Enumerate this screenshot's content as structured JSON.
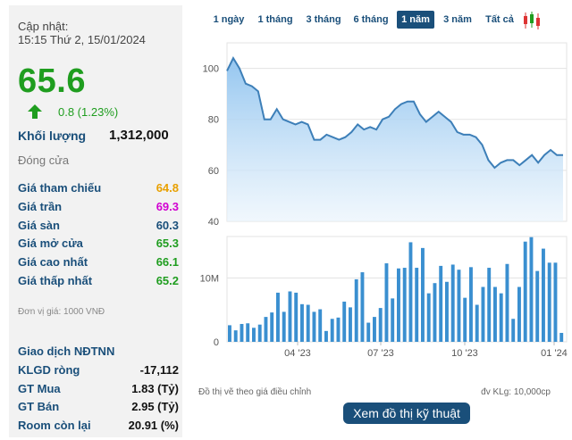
{
  "header": {
    "update_label": "Cập nhật:",
    "update_time": "15:15 Thứ 2, 15/01/2024",
    "price": "65.6",
    "change": "0.8 (1.23%)",
    "volume_label": "Khối lượng",
    "volume_value": "1,312,000",
    "status": "Đóng cửa"
  },
  "prices": [
    {
      "label": "Giá tham chiếu",
      "value": "64.8",
      "color": "#e8a000"
    },
    {
      "label": "Giá trần",
      "value": "69.3",
      "color": "#d100d1"
    },
    {
      "label": "Giá sàn",
      "value": "60.3",
      "color": "#1a4f7a"
    },
    {
      "label": "Giá mở cửa",
      "value": "65.3",
      "color": "#1f9d1f"
    },
    {
      "label": "Giá cao nhất",
      "value": "66.1",
      "color": "#1f9d1f"
    },
    {
      "label": "Giá thấp nhất",
      "value": "65.2",
      "color": "#1f9d1f"
    }
  ],
  "unit_note": "Đơn vị giá: 1000 VNĐ",
  "foreign": {
    "title": "Giao dịch NĐTNN",
    "rows": [
      {
        "label": "KLGD ròng",
        "value": "-17,112"
      },
      {
        "label": "GT Mua",
        "value": "1.83 (Tỷ)"
      },
      {
        "label": "GT Bán",
        "value": "2.95 (Tỷ)"
      },
      {
        "label": "Room còn lại",
        "value": "20.91 (%)"
      }
    ]
  },
  "tabs": [
    "1 ngày",
    "1 tháng",
    "3 tháng",
    "6 tháng",
    "1 năm",
    "3 năm",
    "Tất cả"
  ],
  "active_tab": "1 năm",
  "icons": {
    "change": "up-arrow-icon",
    "chart_type": "candlestick-icon"
  },
  "chart_note_left": "Đồ thị vẽ theo giá điều chỉnh",
  "chart_note_right": "đv KLg: 10,000cp",
  "tech_button": "Xem đồ thị kỹ thuật",
  "colors": {
    "up": "#1f9d1f",
    "accent": "#1a4f7a",
    "line": "#3d7fb8",
    "bar": "#3a8fd0"
  },
  "chart_data": [
    {
      "type": "area",
      "title": "",
      "ylim": [
        40,
        110
      ],
      "yticks": [
        40,
        60,
        80,
        100
      ],
      "xticks": [
        "04 '23",
        "07 '23",
        "10 '23",
        "01 '24"
      ],
      "grid": true,
      "y": [
        99,
        104,
        100,
        94,
        93,
        91,
        80,
        80,
        84,
        80,
        79,
        78,
        79,
        78,
        72,
        72,
        74,
        73,
        72,
        73,
        75,
        78,
        76,
        77,
        76,
        80,
        81,
        84,
        86,
        87,
        87,
        82,
        79,
        81,
        83,
        81,
        79,
        75,
        74,
        74,
        73,
        70,
        64,
        61,
        63,
        64,
        64,
        62,
        64,
        66,
        63,
        66,
        68,
        66,
        66
      ]
    },
    {
      "type": "bar",
      "title": "",
      "ylim": [
        0,
        16.5
      ],
      "yticks": [
        0,
        10
      ],
      "ytick_labels": [
        "0",
        "10M"
      ],
      "values": [
        2.6,
        1.8,
        2.8,
        2.9,
        2.2,
        2.7,
        3.9,
        4.6,
        7.7,
        4.7,
        7.9,
        7.7,
        5.9,
        5.8,
        4.7,
        5.1,
        1.7,
        3.6,
        3.8,
        6.3,
        5.4,
        9.8,
        10.9,
        3.0,
        3.9,
        5.3,
        12.3,
        6.8,
        11.5,
        11.6,
        15.6,
        11.6,
        14.7,
        7.6,
        9.2,
        11.9,
        9.4,
        12.1,
        11.3,
        6.9,
        11.7,
        5.8,
        8.6,
        11.6,
        8.6,
        7.6,
        12.2,
        3.6,
        8.6,
        15.7,
        16.4,
        11.1,
        14.6,
        12.4,
        12.4,
        1.4
      ]
    }
  ]
}
